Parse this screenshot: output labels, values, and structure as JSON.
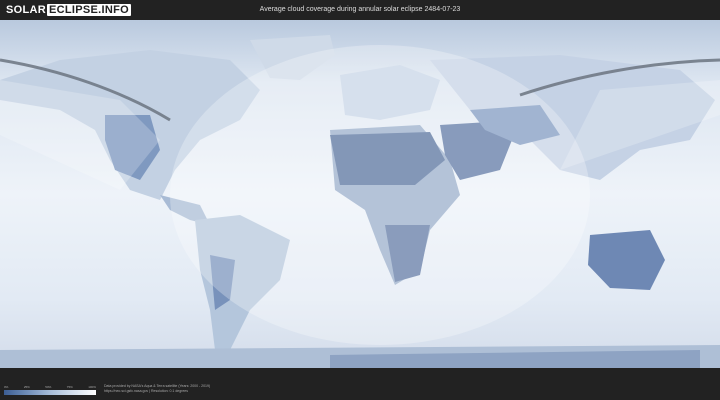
{
  "logo": {
    "part_a": "SOLAR",
    "part_b": "ECLIPSE.INFO"
  },
  "title": "Average cloud coverage during annular solar eclipse 2484-07-23",
  "legend": {
    "ticks": [
      "0%",
      "25%",
      "50%",
      "75%",
      "100%"
    ]
  },
  "credits": {
    "line1": "Data provided by NASA's Aqua & Terra satellite (Years: 2000 - 2019)",
    "line2": "https://neo.sci.gsfc.nasa.gov | Resolution: 0.1 degrees"
  },
  "colors": {
    "background": "#222222",
    "ocean_clear": "#e9f0f8",
    "cloud_low": "#4f6f9f",
    "eclipse_path": "#6b7480"
  }
}
